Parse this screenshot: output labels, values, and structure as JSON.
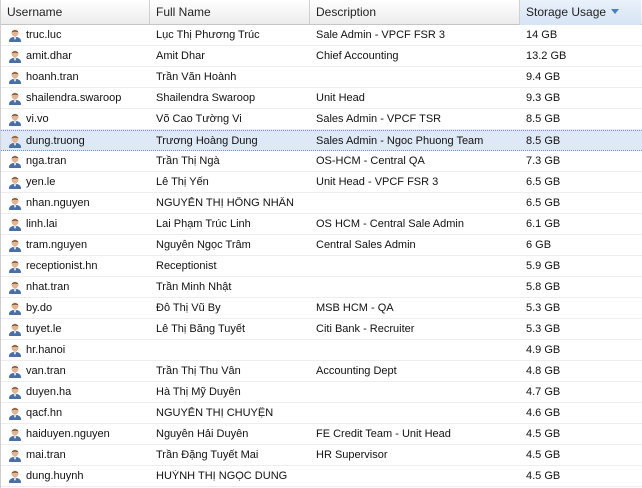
{
  "columns": {
    "username": "Username",
    "full_name": "Full Name",
    "description": "Description",
    "storage": "Storage Usage"
  },
  "rows": [
    {
      "username": "truc.luc",
      "full_name": "Lục Thị Phương Trúc",
      "description": "Sale Admin - VPCF FSR 3",
      "storage": "14 GB"
    },
    {
      "username": "amit.dhar",
      "full_name": "Amit Dhar",
      "description": "Chief Accounting",
      "storage": "13.2 GB"
    },
    {
      "username": "hoanh.tran",
      "full_name": "Trần Văn Hoành",
      "description": "",
      "storage": "9.4 GB"
    },
    {
      "username": "shailendra.swaroop",
      "full_name": "Shailendra Swaroop",
      "description": "Unit Head",
      "storage": "9.3 GB"
    },
    {
      "username": "vi.vo",
      "full_name": "Võ Cao Tường Vi",
      "description": "Sales Admin - VPCF TSR",
      "storage": "8.5 GB"
    },
    {
      "username": "dung.truong",
      "full_name": "Trương Hoàng Dung",
      "description": "Sales Admin - Ngoc Phuong Team",
      "storage": "8.5 GB"
    },
    {
      "username": "nga.tran",
      "full_name": "Trần Thị Ngà",
      "description": "OS-HCM - Central QA",
      "storage": "7.3 GB"
    },
    {
      "username": "yen.le",
      "full_name": "Lê Thị Yến",
      "description": "Unit Head - VPCF FSR 3",
      "storage": "6.5 GB"
    },
    {
      "username": "nhan.nguyen",
      "full_name": "NGUYỄN THỊ HỒNG NHÂN",
      "description": "",
      "storage": "6.5 GB"
    },
    {
      "username": "linh.lai",
      "full_name": "Lai Phạm Trúc Linh",
      "description": "OS HCM - Central Sale Admin",
      "storage": "6.1 GB"
    },
    {
      "username": "tram.nguyen",
      "full_name": "Nguyễn Ngọc Trâm",
      "description": "Central Sales Admin",
      "storage": "6 GB"
    },
    {
      "username": "receptionist.hn",
      "full_name": "Receptionist",
      "description": "",
      "storage": "5.9 GB"
    },
    {
      "username": "nhat.tran",
      "full_name": "Trần Minh Nhật",
      "description": "",
      "storage": "5.8 GB"
    },
    {
      "username": "by.do",
      "full_name": "Đỗ Thị Vũ By",
      "description": "MSB HCM - QA",
      "storage": "5.3 GB"
    },
    {
      "username": "tuyet.le",
      "full_name": "Lê Thị Băng Tuyết",
      "description": "Citi Bank - Recruiter",
      "storage": "5.3 GB"
    },
    {
      "username": "hr.hanoi",
      "full_name": "",
      "description": "",
      "storage": "4.9 GB"
    },
    {
      "username": "van.tran",
      "full_name": "Trần Thị Thu Vân",
      "description": "Accounting Dept",
      "storage": "4.8 GB"
    },
    {
      "username": "duyen.ha",
      "full_name": "Hà Thị Mỹ Duyên",
      "description": "",
      "storage": "4.7 GB"
    },
    {
      "username": "qacf.hn",
      "full_name": "NGUYỄN THỊ CHUYỆN",
      "description": "",
      "storage": "4.6 GB"
    },
    {
      "username": "haiduyen.nguyen",
      "full_name": "Nguyễn Hải Duyên",
      "description": "FE Credit Team - Unit Head",
      "storage": "4.5 GB"
    },
    {
      "username": "mai.tran",
      "full_name": "Trần Đặng Tuyết Mai",
      "description": "HR Supervisor",
      "storage": "4.5 GB"
    },
    {
      "username": "dung.huynh",
      "full_name": "HUỲNH THỊ NGỌC DUNG",
      "description": "",
      "storage": "4.5 GB"
    }
  ],
  "selected_index": 5,
  "icons": {
    "user": "user-icon",
    "sort": "sort-desc-icon"
  },
  "colors": {
    "selected_row": "#dfe8f6",
    "sort_header": "#d6e4f4",
    "user_shirt": "#4a6fa5"
  }
}
